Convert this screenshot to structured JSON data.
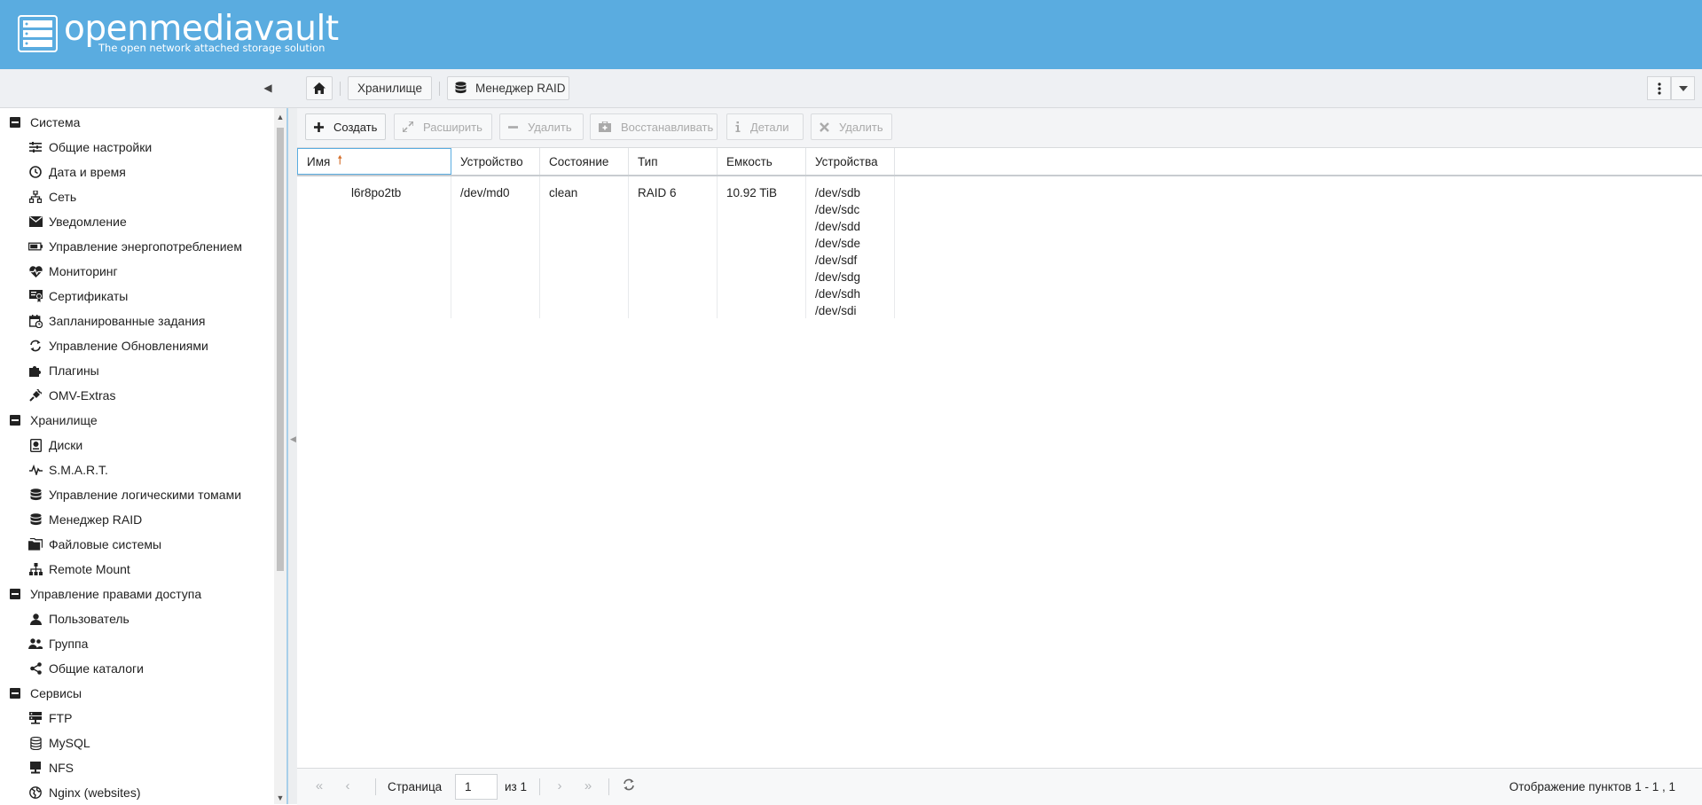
{
  "header": {
    "title": "openmediavault",
    "subtitle": "The open network attached storage solution"
  },
  "breadcrumb": {
    "storage": "Хранилище",
    "current": "Менеджер RAID"
  },
  "sidebar": {
    "groups": [
      {
        "label": "Система",
        "items": [
          {
            "label": "Общие настройки",
            "icon": "sliders-icon"
          },
          {
            "label": "Дата и время",
            "icon": "clock-icon"
          },
          {
            "label": "Сеть",
            "icon": "network-icon"
          },
          {
            "label": "Уведомление",
            "icon": "envelope-icon"
          },
          {
            "label": "Управление энергопотреблением",
            "icon": "battery-icon"
          },
          {
            "label": "Мониторинг",
            "icon": "heartbeat-icon"
          },
          {
            "label": "Сертификаты",
            "icon": "certificate-icon"
          },
          {
            "label": "Запланированные задания",
            "icon": "calendar-clock-icon"
          },
          {
            "label": "Управление Обновлениями",
            "icon": "sync-icon"
          },
          {
            "label": "Плагины",
            "icon": "puzzle-icon"
          },
          {
            "label": "OMV-Extras",
            "icon": "plug-icon"
          }
        ]
      },
      {
        "label": "Хранилище",
        "items": [
          {
            "label": "Диски",
            "icon": "harddisk-icon"
          },
          {
            "label": "S.M.A.R.T.",
            "icon": "pulse-icon"
          },
          {
            "label": "Управление логическими томами",
            "icon": "database-icon"
          },
          {
            "label": "Менеджер RAID",
            "icon": "database-icon"
          },
          {
            "label": "Файловые системы",
            "icon": "folders-icon"
          },
          {
            "label": "Remote Mount",
            "icon": "sitemap-icon"
          }
        ]
      },
      {
        "label": "Управление правами доступа",
        "items": [
          {
            "label": "Пользователь",
            "icon": "user-icon"
          },
          {
            "label": "Группа",
            "icon": "users-icon"
          },
          {
            "label": "Общие каталоги",
            "icon": "share-icon"
          }
        ]
      },
      {
        "label": "Сервисы",
        "items": [
          {
            "label": "FTP",
            "icon": "server-icon"
          },
          {
            "label": "MySQL",
            "icon": "database-outline-icon"
          },
          {
            "label": "NFS",
            "icon": "desktop-icon"
          },
          {
            "label": "Nginx (websites)",
            "icon": "globe-icon"
          }
        ]
      }
    ]
  },
  "actions": {
    "create": "Создать",
    "grow": "Расширить",
    "remove": "Удалить",
    "recover": "Восстанавливать",
    "details": "Детали",
    "delete": "Удалить"
  },
  "grid": {
    "columns": [
      "Имя",
      "Устройство",
      "Состояние",
      "Тип",
      "Емкость",
      "Устройства"
    ],
    "rows": [
      {
        "name": "l6r8po2tb",
        "device": "/dev/md0",
        "state": "clean",
        "type": "RAID 6",
        "capacity": "10.92 TiB",
        "devices": [
          "/dev/sdb",
          "/dev/sdc",
          "/dev/sdd",
          "/dev/sde",
          "/dev/sdf",
          "/dev/sdg",
          "/dev/sdh",
          "/dev/sdi"
        ]
      }
    ]
  },
  "pager": {
    "page_label": "Страница",
    "page_value": "1",
    "of_label": "из 1",
    "info": "Отображение пунктов 1 - 1 , 1"
  }
}
